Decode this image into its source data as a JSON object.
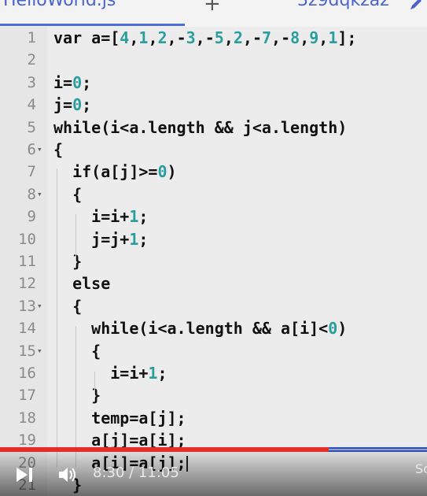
{
  "tab": {
    "filename": "HelloWorld.js",
    "plus": "+",
    "share_id": "3z9dqkzaz"
  },
  "editor": {
    "lines": [
      {
        "n": "1",
        "fold": "",
        "code": [
          [
            "t",
            "var a=["
          ],
          [
            "n",
            "4"
          ],
          [
            "t",
            ","
          ],
          [
            "n",
            "1"
          ],
          [
            "t",
            ","
          ],
          [
            "n",
            "2"
          ],
          [
            "t",
            ",-"
          ],
          [
            "n",
            "3"
          ],
          [
            "t",
            ",-"
          ],
          [
            "n",
            "5"
          ],
          [
            "t",
            ","
          ],
          [
            "n",
            "2"
          ],
          [
            "t",
            ",-"
          ],
          [
            "n",
            "7"
          ],
          [
            "t",
            ",-"
          ],
          [
            "n",
            "8"
          ],
          [
            "t",
            ","
          ],
          [
            "n",
            "9"
          ],
          [
            "t",
            ","
          ],
          [
            "n",
            "1"
          ],
          [
            "t",
            "];"
          ]
        ]
      },
      {
        "n": "2",
        "fold": "",
        "code": []
      },
      {
        "n": "3",
        "fold": "",
        "code": [
          [
            "t",
            "i="
          ],
          [
            "n",
            "0"
          ],
          [
            "t",
            ";"
          ]
        ]
      },
      {
        "n": "4",
        "fold": "",
        "code": [
          [
            "t",
            "j="
          ],
          [
            "n",
            "0"
          ],
          [
            "t",
            ";"
          ]
        ]
      },
      {
        "n": "5",
        "fold": "",
        "code": [
          [
            "t",
            "while(i<a.length && j<a.length)"
          ]
        ]
      },
      {
        "n": "6",
        "fold": "▾",
        "code": [
          [
            "t",
            "{"
          ]
        ]
      },
      {
        "n": "7",
        "fold": "",
        "code": [
          [
            "t",
            "  if(a[j]>="
          ],
          [
            "n",
            "0"
          ],
          [
            "t",
            ")"
          ]
        ]
      },
      {
        "n": "8",
        "fold": "▾",
        "code": [
          [
            "t",
            "  {"
          ]
        ]
      },
      {
        "n": "9",
        "fold": "",
        "code": [
          [
            "t",
            "    i=i+"
          ],
          [
            "n",
            "1"
          ],
          [
            "t",
            ";"
          ]
        ]
      },
      {
        "n": "10",
        "fold": "",
        "code": [
          [
            "t",
            "    j=j+"
          ],
          [
            "n",
            "1"
          ],
          [
            "t",
            ";"
          ]
        ]
      },
      {
        "n": "11",
        "fold": "",
        "code": [
          [
            "t",
            "  }"
          ]
        ]
      },
      {
        "n": "12",
        "fold": "",
        "code": [
          [
            "t",
            "  else"
          ]
        ]
      },
      {
        "n": "13",
        "fold": "▾",
        "code": [
          [
            "t",
            "  {"
          ]
        ]
      },
      {
        "n": "14",
        "fold": "",
        "code": [
          [
            "t",
            "    while(i<a.length && a[i]<"
          ],
          [
            "n",
            "0"
          ],
          [
            "t",
            ")"
          ]
        ]
      },
      {
        "n": "15",
        "fold": "▾",
        "code": [
          [
            "t",
            "    {"
          ]
        ]
      },
      {
        "n": "16",
        "fold": "",
        "code": [
          [
            "t",
            "      i=i+"
          ],
          [
            "n",
            "1"
          ],
          [
            "t",
            ";"
          ]
        ]
      },
      {
        "n": "17",
        "fold": "",
        "code": [
          [
            "t",
            "    }"
          ]
        ]
      },
      {
        "n": "18",
        "fold": "",
        "code": [
          [
            "t",
            "    temp=a[j];"
          ]
        ]
      },
      {
        "n": "19",
        "fold": "",
        "code": [
          [
            "t",
            "    a[j]=a[i];"
          ]
        ]
      },
      {
        "n": "20",
        "fold": "",
        "code": [
          [
            "t",
            "    a[i]=a[j];"
          ],
          [
            "c",
            ""
          ]
        ]
      },
      {
        "n": "21",
        "fold": "",
        "code": [
          [
            "t",
            "  }"
          ]
        ]
      }
    ]
  },
  "player": {
    "time": "8:30 / 11:05",
    "progress": 0.77,
    "extra": "Sc",
    "icons": {
      "play": "play-pause-icon",
      "volume": "volume-icon",
      "pencil": "pencil-icon"
    },
    "colors": {
      "progress": "#e52d27",
      "track": "#8fa0c8",
      "accent": "#4a63c9",
      "number": "#2a9d9d"
    }
  }
}
